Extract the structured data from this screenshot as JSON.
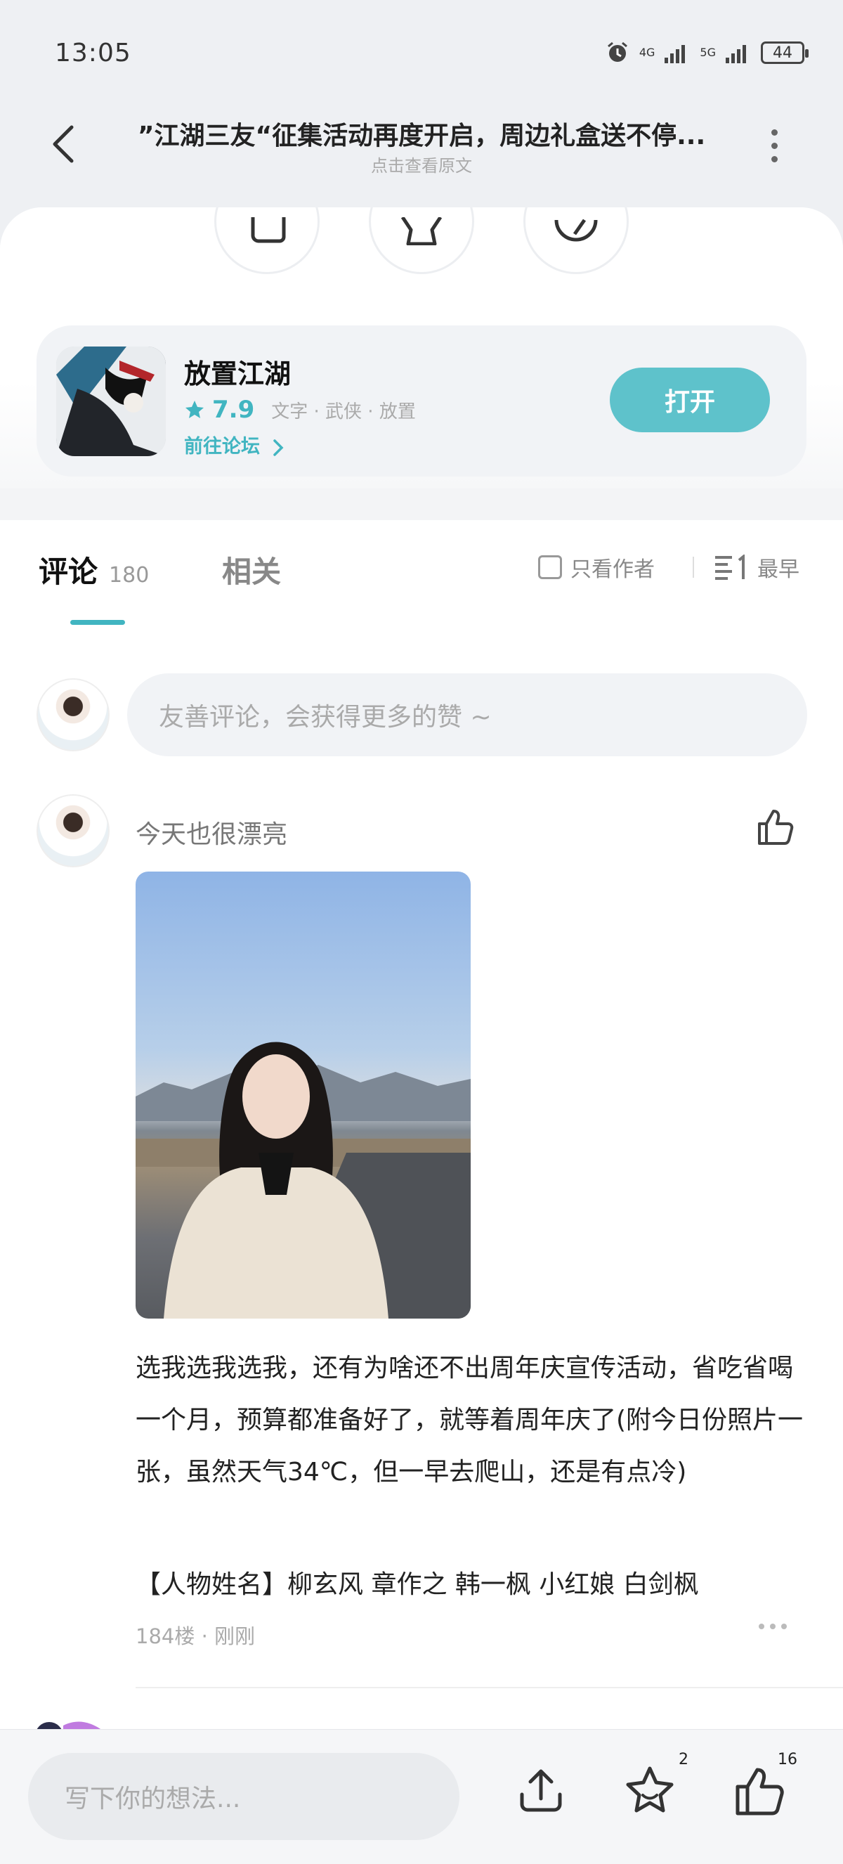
{
  "status": {
    "time": "13:05",
    "network1": "4G",
    "network2": "5G",
    "battery": "44"
  },
  "header": {
    "title": "”江湖三友“征集活动再度开启，周边礼盒送不停...",
    "subtitle": "点击查看原文"
  },
  "app": {
    "name": "放置江湖",
    "rating": "7.9",
    "tags": "文字 · 武侠 · 放置",
    "forum_link": "前往论坛",
    "open_label": "打开"
  },
  "tabs": {
    "comments_label": "评论",
    "comments_count": "180",
    "related_label": "相关",
    "author_only": "只看作者",
    "sort_label": "最早"
  },
  "composer": {
    "placeholder": "友善评论，会获得更多的赞 ~"
  },
  "comment": {
    "author": "今天也很漂亮",
    "text": "选我选我选我，还有为啥还不出周年庆宣传活动，省吃省喝一个月，预算都准备好了，就等着周年庆了(附今日份照片一张，虽然天气34℃，但一早去爬山，还是有点冷)",
    "tags": "【人物姓名】柳玄风 章作之 韩一枫 小红娘 白剑枫",
    "floor_time": "184楼 · 刚刚"
  },
  "bottom": {
    "placeholder": "写下你的想法...",
    "favorite_count": "2",
    "like_count": "16"
  },
  "colors": {
    "accent": "#41b5c1",
    "button": "#5ec2cb"
  },
  "icons": [
    "back-icon",
    "more-icon",
    "alarm-icon",
    "signal-icon",
    "battery-icon",
    "thumbs-up-icon",
    "star-icon",
    "share-icon",
    "sort-icon",
    "chevron-right-icon"
  ]
}
